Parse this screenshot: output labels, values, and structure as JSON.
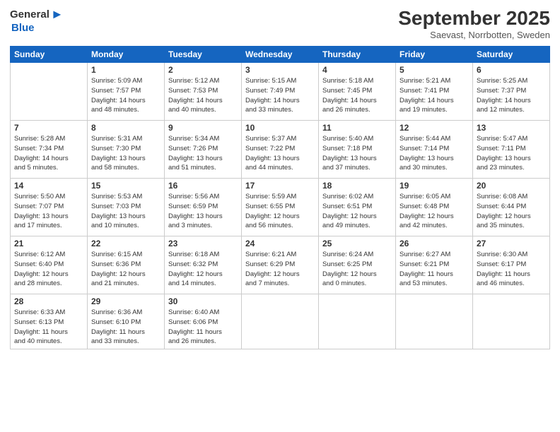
{
  "header": {
    "logo_general": "General",
    "logo_blue": "Blue",
    "month": "September 2025",
    "location": "Saevast, Norrbotten, Sweden"
  },
  "days_of_week": [
    "Sunday",
    "Monday",
    "Tuesday",
    "Wednesday",
    "Thursday",
    "Friday",
    "Saturday"
  ],
  "weeks": [
    [
      {
        "day": "",
        "info": ""
      },
      {
        "day": "1",
        "info": "Sunrise: 5:09 AM\nSunset: 7:57 PM\nDaylight: 14 hours\nand 48 minutes."
      },
      {
        "day": "2",
        "info": "Sunrise: 5:12 AM\nSunset: 7:53 PM\nDaylight: 14 hours\nand 40 minutes."
      },
      {
        "day": "3",
        "info": "Sunrise: 5:15 AM\nSunset: 7:49 PM\nDaylight: 14 hours\nand 33 minutes."
      },
      {
        "day": "4",
        "info": "Sunrise: 5:18 AM\nSunset: 7:45 PM\nDaylight: 14 hours\nand 26 minutes."
      },
      {
        "day": "5",
        "info": "Sunrise: 5:21 AM\nSunset: 7:41 PM\nDaylight: 14 hours\nand 19 minutes."
      },
      {
        "day": "6",
        "info": "Sunrise: 5:25 AM\nSunset: 7:37 PM\nDaylight: 14 hours\nand 12 minutes."
      }
    ],
    [
      {
        "day": "7",
        "info": "Sunrise: 5:28 AM\nSunset: 7:34 PM\nDaylight: 14 hours\nand 5 minutes."
      },
      {
        "day": "8",
        "info": "Sunrise: 5:31 AM\nSunset: 7:30 PM\nDaylight: 13 hours\nand 58 minutes."
      },
      {
        "day": "9",
        "info": "Sunrise: 5:34 AM\nSunset: 7:26 PM\nDaylight: 13 hours\nand 51 minutes."
      },
      {
        "day": "10",
        "info": "Sunrise: 5:37 AM\nSunset: 7:22 PM\nDaylight: 13 hours\nand 44 minutes."
      },
      {
        "day": "11",
        "info": "Sunrise: 5:40 AM\nSunset: 7:18 PM\nDaylight: 13 hours\nand 37 minutes."
      },
      {
        "day": "12",
        "info": "Sunrise: 5:44 AM\nSunset: 7:14 PM\nDaylight: 13 hours\nand 30 minutes."
      },
      {
        "day": "13",
        "info": "Sunrise: 5:47 AM\nSunset: 7:11 PM\nDaylight: 13 hours\nand 23 minutes."
      }
    ],
    [
      {
        "day": "14",
        "info": "Sunrise: 5:50 AM\nSunset: 7:07 PM\nDaylight: 13 hours\nand 17 minutes."
      },
      {
        "day": "15",
        "info": "Sunrise: 5:53 AM\nSunset: 7:03 PM\nDaylight: 13 hours\nand 10 minutes."
      },
      {
        "day": "16",
        "info": "Sunrise: 5:56 AM\nSunset: 6:59 PM\nDaylight: 13 hours\nand 3 minutes."
      },
      {
        "day": "17",
        "info": "Sunrise: 5:59 AM\nSunset: 6:55 PM\nDaylight: 12 hours\nand 56 minutes."
      },
      {
        "day": "18",
        "info": "Sunrise: 6:02 AM\nSunset: 6:51 PM\nDaylight: 12 hours\nand 49 minutes."
      },
      {
        "day": "19",
        "info": "Sunrise: 6:05 AM\nSunset: 6:48 PM\nDaylight: 12 hours\nand 42 minutes."
      },
      {
        "day": "20",
        "info": "Sunrise: 6:08 AM\nSunset: 6:44 PM\nDaylight: 12 hours\nand 35 minutes."
      }
    ],
    [
      {
        "day": "21",
        "info": "Sunrise: 6:12 AM\nSunset: 6:40 PM\nDaylight: 12 hours\nand 28 minutes."
      },
      {
        "day": "22",
        "info": "Sunrise: 6:15 AM\nSunset: 6:36 PM\nDaylight: 12 hours\nand 21 minutes."
      },
      {
        "day": "23",
        "info": "Sunrise: 6:18 AM\nSunset: 6:32 PM\nDaylight: 12 hours\nand 14 minutes."
      },
      {
        "day": "24",
        "info": "Sunrise: 6:21 AM\nSunset: 6:29 PM\nDaylight: 12 hours\nand 7 minutes."
      },
      {
        "day": "25",
        "info": "Sunrise: 6:24 AM\nSunset: 6:25 PM\nDaylight: 12 hours\nand 0 minutes."
      },
      {
        "day": "26",
        "info": "Sunrise: 6:27 AM\nSunset: 6:21 PM\nDaylight: 11 hours\nand 53 minutes."
      },
      {
        "day": "27",
        "info": "Sunrise: 6:30 AM\nSunset: 6:17 PM\nDaylight: 11 hours\nand 46 minutes."
      }
    ],
    [
      {
        "day": "28",
        "info": "Sunrise: 6:33 AM\nSunset: 6:13 PM\nDaylight: 11 hours\nand 40 minutes."
      },
      {
        "day": "29",
        "info": "Sunrise: 6:36 AM\nSunset: 6:10 PM\nDaylight: 11 hours\nand 33 minutes."
      },
      {
        "day": "30",
        "info": "Sunrise: 6:40 AM\nSunset: 6:06 PM\nDaylight: 11 hours\nand 26 minutes."
      },
      {
        "day": "",
        "info": ""
      },
      {
        "day": "",
        "info": ""
      },
      {
        "day": "",
        "info": ""
      },
      {
        "day": "",
        "info": ""
      }
    ]
  ]
}
